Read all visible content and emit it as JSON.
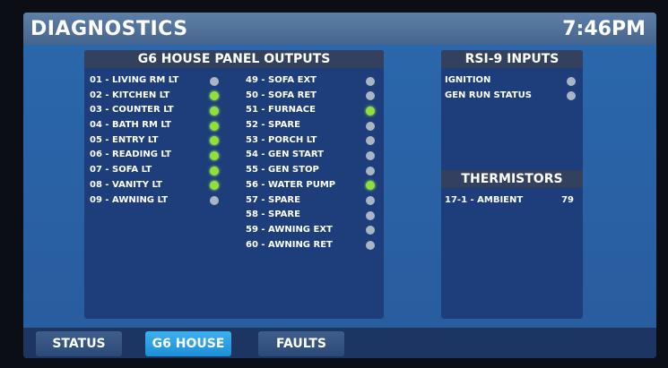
{
  "header": {
    "title": "DIAGNOSTICS",
    "time": "7:46PM"
  },
  "outputs_panel": {
    "title": "G6 HOUSE PANEL OUTPUTS",
    "left_items": [
      {
        "label": "01 - LIVING RM LT",
        "state": "off"
      },
      {
        "label": "02 - KITCHEN LT",
        "state": "on"
      },
      {
        "label": "03 - COUNTER LT",
        "state": "on"
      },
      {
        "label": "04 - BATH RM LT",
        "state": "on"
      },
      {
        "label": "05 - ENTRY LT",
        "state": "on"
      },
      {
        "label": "06 - READING LT",
        "state": "on"
      },
      {
        "label": "07 - SOFA LT",
        "state": "on"
      },
      {
        "label": "08 - VANITY LT",
        "state": "on"
      },
      {
        "label": "09 - AWNING LT",
        "state": "off"
      }
    ],
    "right_items": [
      {
        "label": "49 - SOFA EXT",
        "state": "off"
      },
      {
        "label": "50 - SOFA RET",
        "state": "off"
      },
      {
        "label": "51 - FURNACE",
        "state": "on"
      },
      {
        "label": "52 - SPARE",
        "state": "off"
      },
      {
        "label": "53 - PORCH LT",
        "state": "off"
      },
      {
        "label": "54 - GEN START",
        "state": "off"
      },
      {
        "label": "55 - GEN STOP",
        "state": "off"
      },
      {
        "label": "56 - WATER PUMP",
        "state": "on"
      },
      {
        "label": "57 - SPARE",
        "state": "off"
      },
      {
        "label": "58 - SPARE",
        "state": "off"
      },
      {
        "label": "59 - AWNING EXT",
        "state": "off"
      },
      {
        "label": "60 - AWNING RET",
        "state": "off"
      }
    ]
  },
  "inputs_panel": {
    "title": "RSI-9 INPUTS",
    "items": [
      {
        "label": "IGNITION",
        "state": "off"
      },
      {
        "label": "GEN RUN STATUS",
        "state": "off"
      }
    ]
  },
  "thermistors": {
    "title": "THERMISTORS",
    "label": "17-1 - AMBIENT",
    "value": "79"
  },
  "tabs": [
    {
      "label": "STATUS",
      "active": false
    },
    {
      "label": "G6 HOUSE",
      "active": true
    },
    {
      "label": "FAULTS",
      "active": false
    }
  ],
  "colors": {
    "indicator_on": "#8fe03a",
    "indicator_off": "#aab4c4",
    "tab_active": "#2ea3e6"
  }
}
